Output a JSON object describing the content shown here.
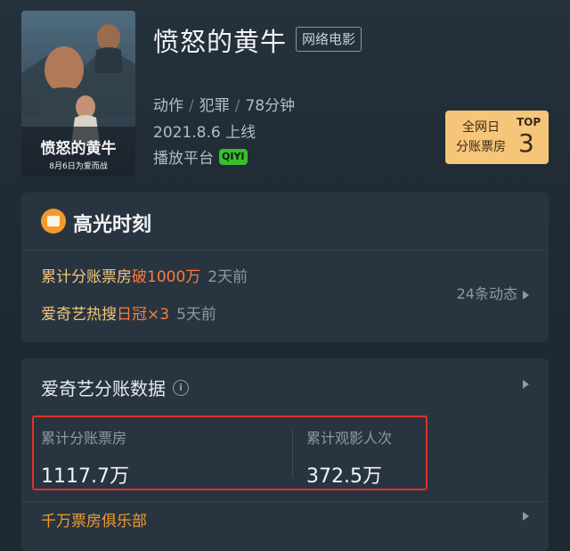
{
  "movie": {
    "title": "愤怒的黄牛",
    "badge": "网络电影",
    "genres": [
      "动作",
      "犯罪",
      "78分钟"
    ],
    "release": "2021.8.6 上线",
    "platform_label": "播放平台",
    "platform_logo_text": "QIYI"
  },
  "poster": {
    "title_text": "愤怒的黄牛",
    "date_text": "8月6日为爱而战"
  },
  "rank": {
    "line1": "全网日",
    "line2": "分账票房",
    "top_label": "TOP",
    "top_number": "3"
  },
  "highlights": {
    "title": "高光时刻",
    "row1": {
      "prefix": "累计分账票房",
      "emphasis": "破1000万",
      "ago": "2天前"
    },
    "row2": {
      "prefix": "爱奇艺热搜",
      "emphasis": "日冠×3",
      "ago": "5天前"
    },
    "more": "24条动态"
  },
  "data_section": {
    "title": "爱奇艺分账数据",
    "stats": [
      {
        "label": "累计分账票房",
        "value": "1117.7万"
      },
      {
        "label": "累计观影人次",
        "value": "372.5万"
      }
    ],
    "club": "千万票房俱乐部"
  },
  "colors": {
    "accent_orange": "#ff7a3b",
    "gold": "#f5c57a",
    "highlight_border": "#e0302a"
  }
}
